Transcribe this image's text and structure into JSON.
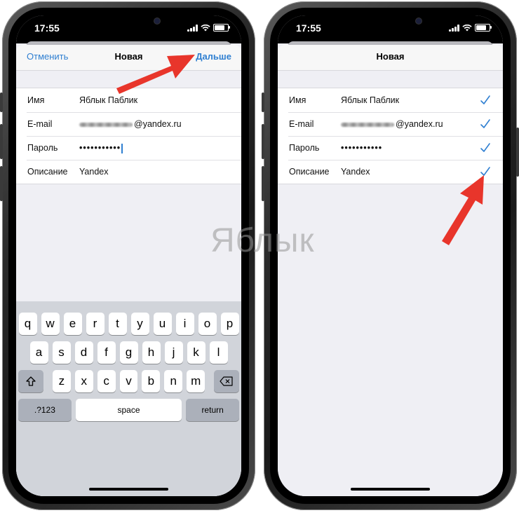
{
  "watermark": "Яблык",
  "left": {
    "status": {
      "time": "17:55"
    },
    "nav": {
      "cancel": "Отменить",
      "title": "Новая",
      "next": "Дальше"
    },
    "fields": [
      {
        "label": "Имя",
        "value": "Яблык Паблик"
      },
      {
        "label": "E-mail",
        "value": "@yandex.ru"
      },
      {
        "label": "Пароль",
        "value": "•••••••••••"
      },
      {
        "label": "Описание",
        "value": "Yandex"
      }
    ],
    "keyboard": {
      "row1": [
        "q",
        "w",
        "e",
        "r",
        "t",
        "y",
        "u",
        "i",
        "o",
        "p"
      ],
      "row2": [
        "a",
        "s",
        "d",
        "f",
        "g",
        "h",
        "j",
        "k",
        "l"
      ],
      "row3": [
        "z",
        "x",
        "c",
        "v",
        "b",
        "n",
        "m"
      ],
      "numbers": ".?123",
      "space": "space",
      "return": "return"
    }
  },
  "right": {
    "status": {
      "time": "17:55"
    },
    "nav": {
      "title": "Новая"
    },
    "fields": [
      {
        "label": "Имя",
        "value": "Яблык Паблик"
      },
      {
        "label": "E-mail",
        "value": "@yandex.ru"
      },
      {
        "label": "Пароль",
        "value": "•••••••••••"
      },
      {
        "label": "Описание",
        "value": "Yandex"
      }
    ]
  },
  "colors": {
    "accent": "#2f7fd1",
    "arrow": "#e8352b",
    "keyboard_bg": "#d1d4da"
  }
}
